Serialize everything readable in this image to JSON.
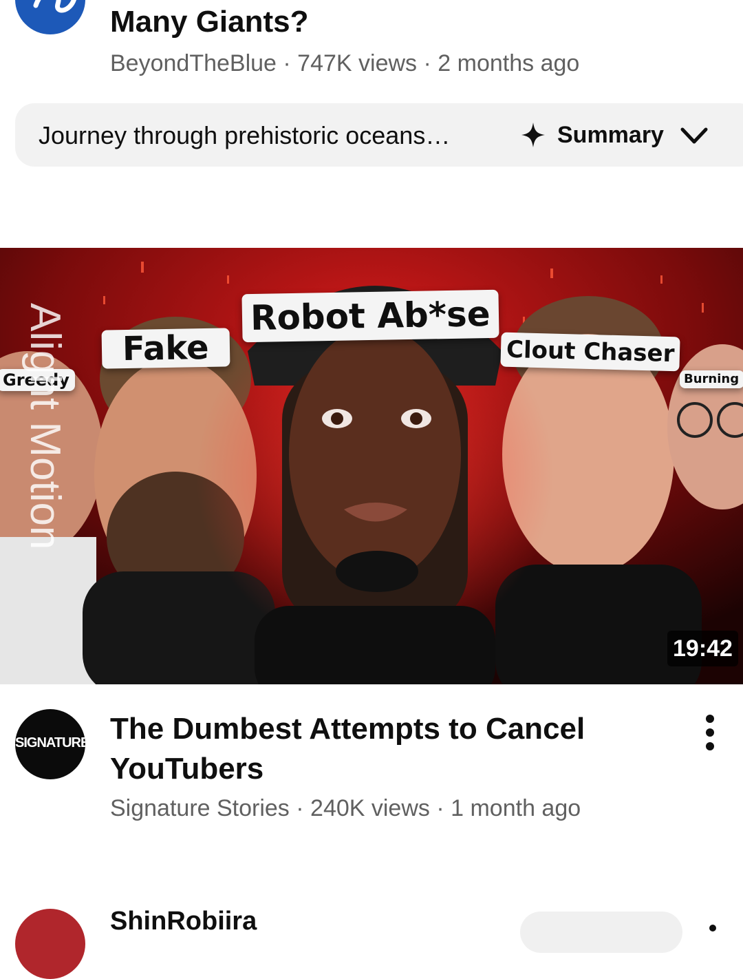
{
  "video_top": {
    "title": "Many Giants?",
    "channel": "BeyondTheBlue",
    "views": "747K views",
    "age": "2 months ago",
    "avatar_icon": "channel-logo-icon"
  },
  "summary": {
    "text": "Journey through prehistoric oceans…",
    "label": "Summary",
    "icons": [
      "sparkle-icon",
      "chevron-down-icon"
    ]
  },
  "video_main": {
    "thumbnail": {
      "tags": [
        "Greedy",
        "Fake",
        "Robot Ab*se",
        "Clout Chaser",
        "Burning"
      ],
      "watermark": "Alight Motion",
      "duration": "19:42",
      "colors": {
        "background": "#2a0606",
        "glow": "#d11a1a"
      }
    },
    "avatar_text": "SIGNATURE",
    "title": "The Dumbest Attempts to Cancel YouTubers",
    "channel": "Signature Stories",
    "views": "240K views",
    "age": "1 month ago",
    "more_icon": "more-vertical-icon"
  },
  "video_next": {
    "channel": "ShinRobiira"
  },
  "separator": " · "
}
